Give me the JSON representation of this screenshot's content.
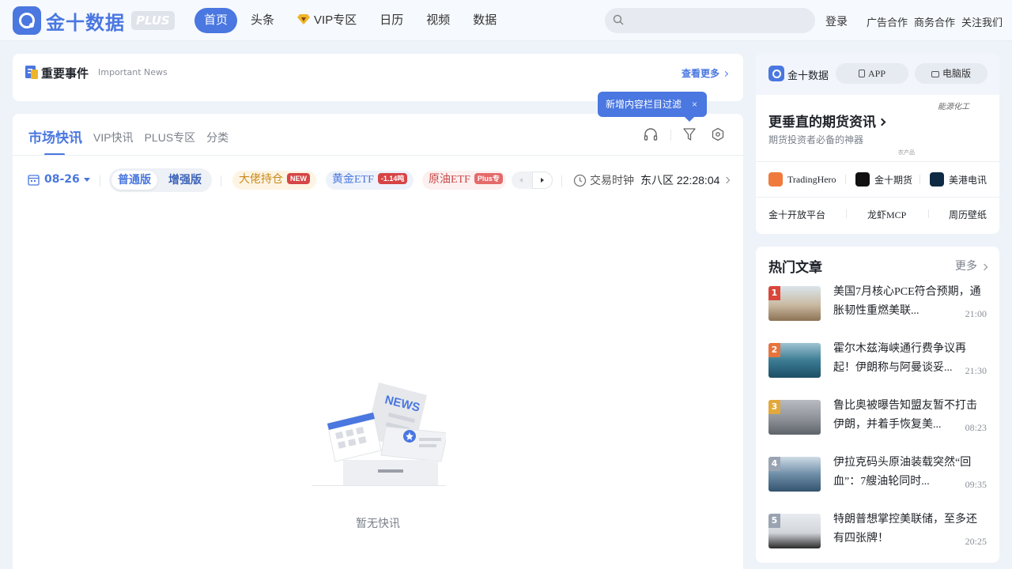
{
  "header": {
    "logo_text": "金十数据",
    "logo_badge": "PLUS",
    "nav": [
      "首页",
      "头条",
      "VIP专区",
      "日历",
      "视频",
      "数据"
    ],
    "active_nav": "首页",
    "search_placeholder": "",
    "links": [
      "登录",
      "广告合作",
      "商务合作",
      "关注我们"
    ]
  },
  "important_news": {
    "title": "重要事件",
    "subtitle": "Important News",
    "more": "查看更多"
  },
  "tooltip": {
    "text": "新增内容栏目过滤",
    "close": "×"
  },
  "feed": {
    "tabs": [
      "市场快讯",
      "VIP快讯",
      "PLUS专区",
      "分类"
    ],
    "active_tab": "市场快讯",
    "date": "08-26",
    "mode_normal": "普通版",
    "mode_enhanced": "增强版",
    "chips": [
      {
        "label": "大佬持仓",
        "tag": "NEW"
      },
      {
        "label": "黄金ETF",
        "tag": "-1.14吨"
      },
      {
        "label": "原油ETF",
        "tag": "Plus专"
      }
    ],
    "clock_label": "交易时钟",
    "clock_time": "东八区 22:28:04",
    "empty_badge": "NEWS",
    "empty_text": "暂无快讯"
  },
  "side_promo": {
    "brand": "金十数据",
    "app_btn": "APP",
    "pc_btn": "电脑版",
    "title": "更垂直的期货资讯",
    "subtitle": "期货投资者必备的神器",
    "tag_top": "能源化工",
    "tag_small": "农产品",
    "apps": [
      "TradingHero",
      "金十期货",
      "美港电讯"
    ],
    "links": [
      "金十开放平台",
      "龙虾MCP",
      "周历壁纸"
    ]
  },
  "hot_articles": {
    "title": "热门文章",
    "more": "更多",
    "items": [
      {
        "rank": "1",
        "title": "美国7月核心PCE符合预期，通胀韧性重燃美联...",
        "time": "21:00"
      },
      {
        "rank": "2",
        "title": "霍尔木兹海峡通行费争议再起！伊朗称与阿曼谈妥...",
        "time": "21:30"
      },
      {
        "rank": "3",
        "title": "鲁比奥被曝告知盟友暂不打击伊朗，并着手恢复美...",
        "time": "08:23"
      },
      {
        "rank": "4",
        "title": "伊拉克码头原油装载突然“回血”：7艘油轮同时...",
        "time": "09:35"
      },
      {
        "rank": "5",
        "title": "特朗普想掌控美联储，至多还有四张牌！",
        "time": "20:25"
      }
    ]
  },
  "colors": {
    "accent": "#4a77e0",
    "rank1": "#d9473a",
    "rank2": "#e8743c",
    "rank3": "#e3a83a",
    "rank4": "#9aa3b2",
    "rank5": "#9aa3b2"
  }
}
